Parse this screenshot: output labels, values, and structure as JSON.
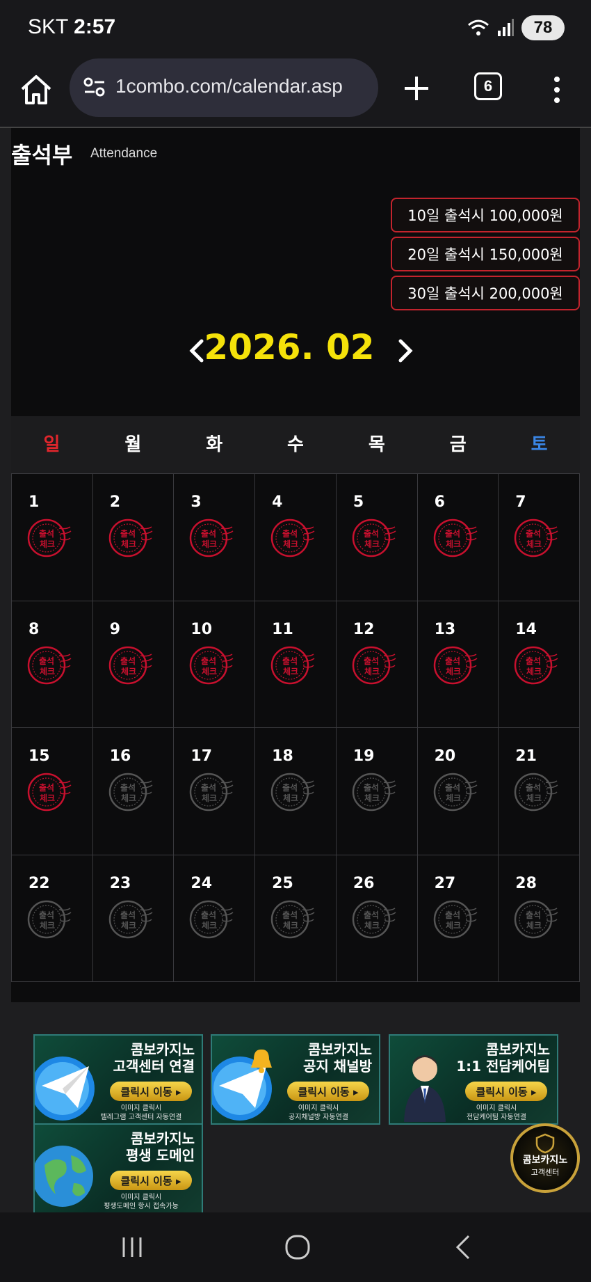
{
  "status_bar": {
    "carrier": "SKT",
    "time": "2:57",
    "battery": "78"
  },
  "browser": {
    "url": "1combo.com/calendar.asp",
    "tab_count": "6"
  },
  "page": {
    "title_ko": "출석부",
    "title_en": "Attendance",
    "rewards": [
      "10일 출석시 100,000원",
      "20일 출석시 150,000원",
      "30일 출석시 200,000원"
    ],
    "month": "2026. 02",
    "weekdays": [
      "일",
      "월",
      "화",
      "수",
      "목",
      "금",
      "토"
    ],
    "stamp_text_top": "출석",
    "stamp_text_bottom": "체크",
    "days": [
      {
        "day": "1",
        "checked": true
      },
      {
        "day": "2",
        "checked": true
      },
      {
        "day": "3",
        "checked": true
      },
      {
        "day": "4",
        "checked": true
      },
      {
        "day": "5",
        "checked": true
      },
      {
        "day": "6",
        "checked": true
      },
      {
        "day": "7",
        "checked": true
      },
      {
        "day": "8",
        "checked": true
      },
      {
        "day": "9",
        "checked": true
      },
      {
        "day": "10",
        "checked": true
      },
      {
        "day": "11",
        "checked": true
      },
      {
        "day": "12",
        "checked": true
      },
      {
        "day": "13",
        "checked": true
      },
      {
        "day": "14",
        "checked": true
      },
      {
        "day": "15",
        "checked": true
      },
      {
        "day": "16",
        "checked": false
      },
      {
        "day": "17",
        "checked": false
      },
      {
        "day": "18",
        "checked": false
      },
      {
        "day": "19",
        "checked": false
      },
      {
        "day": "20",
        "checked": false
      },
      {
        "day": "21",
        "checked": false
      },
      {
        "day": "22",
        "checked": false
      },
      {
        "day": "23",
        "checked": false
      },
      {
        "day": "24",
        "checked": false
      },
      {
        "day": "25",
        "checked": false
      },
      {
        "day": "26",
        "checked": false
      },
      {
        "day": "27",
        "checked": false
      },
      {
        "day": "28",
        "checked": false
      }
    ],
    "colors": {
      "accent_yellow": "#f5e20a",
      "stamp_red": "#c8102e",
      "stamp_gray": "#555555",
      "sunday": "#e1262c",
      "saturday": "#3a86e6"
    }
  },
  "banners": [
    {
      "line1": "콤보카지노",
      "line2": "고객센터 연결",
      "button": "클릭시 이동 ▸",
      "sub1": "이미지 클릭시",
      "sub2": "텔레그램 고객센터 자동연결",
      "icon": "telegram-icon"
    },
    {
      "line1": "콤보카지노",
      "line2": "공지 채널방",
      "button": "클릭시 이동 ▸",
      "sub1": "이미지 클릭시",
      "sub2": "공지채널방 자동연결",
      "icon": "telegram-bell-icon"
    },
    {
      "line1": "콤보카지노",
      "line2": "1:1 전담케어팀",
      "button": "클릭시 이동 ▸",
      "sub1": "이미지 클릭시",
      "sub2": "전담케어팀 자동연결",
      "icon": "agent-avatar-icon"
    },
    {
      "line1": "콤보카지노",
      "line2": "평생 도메인",
      "button": "클릭시 이동 ▸",
      "sub1": "이미지 클릭시",
      "sub2": "평생도메인 항시 접속가능",
      "icon": "globe-icon"
    }
  ],
  "cs_badge": {
    "line1": "콤보카지노",
    "line2": "고객센터"
  }
}
